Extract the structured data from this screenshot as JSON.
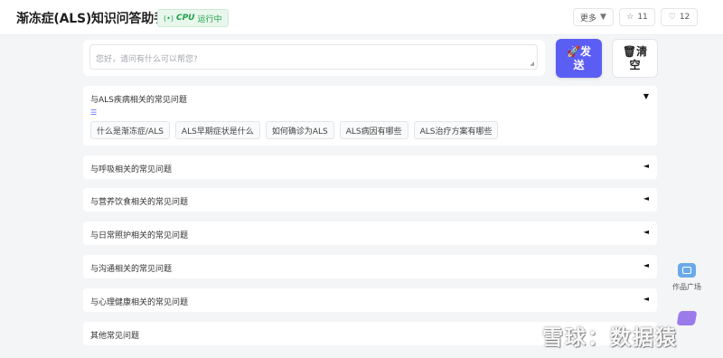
{
  "header": {
    "title": "渐冻症(ALS)知识问答助手",
    "status": {
      "signal_icon": "(•)",
      "cpu": "CPU",
      "text": "运行中",
      "color": "#20a04a"
    },
    "more_label": "更多",
    "star_count": "11",
    "like_count": "12"
  },
  "input": {
    "placeholder": "您好，请问有什么可以帮您?"
  },
  "actions": {
    "send_icon": "🚀",
    "send_line1": "发",
    "send_line2": "送",
    "clear_icon": "🗑",
    "clear_line1": "清",
    "clear_line2": "空",
    "send_color": "#5b5ef3"
  },
  "sections": [
    {
      "label": "与ALS疾病相关的常见问题",
      "state": "expanded",
      "arrow": "▼",
      "chips": [
        "什么是渐冻症/ALS",
        "ALS早期症状是什么",
        "如何确诊为ALS",
        "ALS病因有哪些",
        "ALS治疗方案有哪些"
      ]
    },
    {
      "label": "与呼吸相关的常见问题",
      "state": "collapsed",
      "arrow": "◄"
    },
    {
      "label": "与营养饮食相关的常见问题",
      "state": "collapsed",
      "arrow": "◄"
    },
    {
      "label": "与日常照护相关的常见问题",
      "state": "collapsed",
      "arrow": "◄"
    },
    {
      "label": "与沟通相关的常见问题",
      "state": "collapsed",
      "arrow": "◄"
    },
    {
      "label": "与心理健康相关的常见问题",
      "state": "collapsed",
      "arrow": "◄"
    },
    {
      "label": "其他常见问题",
      "state": "collapsed",
      "arrow": ""
    }
  ],
  "side": {
    "gallery_label": "作品广场"
  },
  "watermark": "雪球：数据猿"
}
